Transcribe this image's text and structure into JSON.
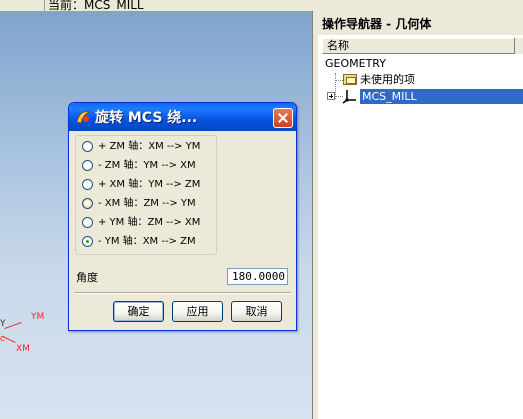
{
  "window": {
    "current_label": "当前：MCS_MILL"
  },
  "viewport": {
    "axis_labels": {
      "ym": "YM",
      "xm": "XM",
      "y_partial": "Y"
    }
  },
  "navigator": {
    "title": "操作导航器 - 几何体",
    "column_header": "名称",
    "root": "GEOMETRY",
    "items": [
      {
        "label": "未使用的项",
        "icon": "folder-icon"
      },
      {
        "label": "MCS_MILL",
        "icon": "mcs-axis-icon",
        "selected": true
      }
    ]
  },
  "dialog": {
    "title": "旋转 MCS 绕...",
    "options": [
      {
        "label": "+ ZM 轴：XM --> YM",
        "checked": false
      },
      {
        "label": "- ZM 轴：YM --> XM",
        "checked": false
      },
      {
        "label": "+ XM 轴：YM --> ZM",
        "checked": false
      },
      {
        "label": "- XM 轴：ZM --> YM",
        "checked": false
      },
      {
        "label": "+ YM 轴：ZM --> XM",
        "checked": false
      },
      {
        "label": "- YM 轴：XM --> ZM",
        "checked": true
      }
    ],
    "angle_label": "角度",
    "angle_value": "180.0000",
    "buttons": {
      "ok": "确定",
      "apply": "应用",
      "cancel": "取消"
    }
  },
  "colors": {
    "titlebar": "#0553e0",
    "selection": "#316ac5",
    "axis": "#ff2020"
  }
}
